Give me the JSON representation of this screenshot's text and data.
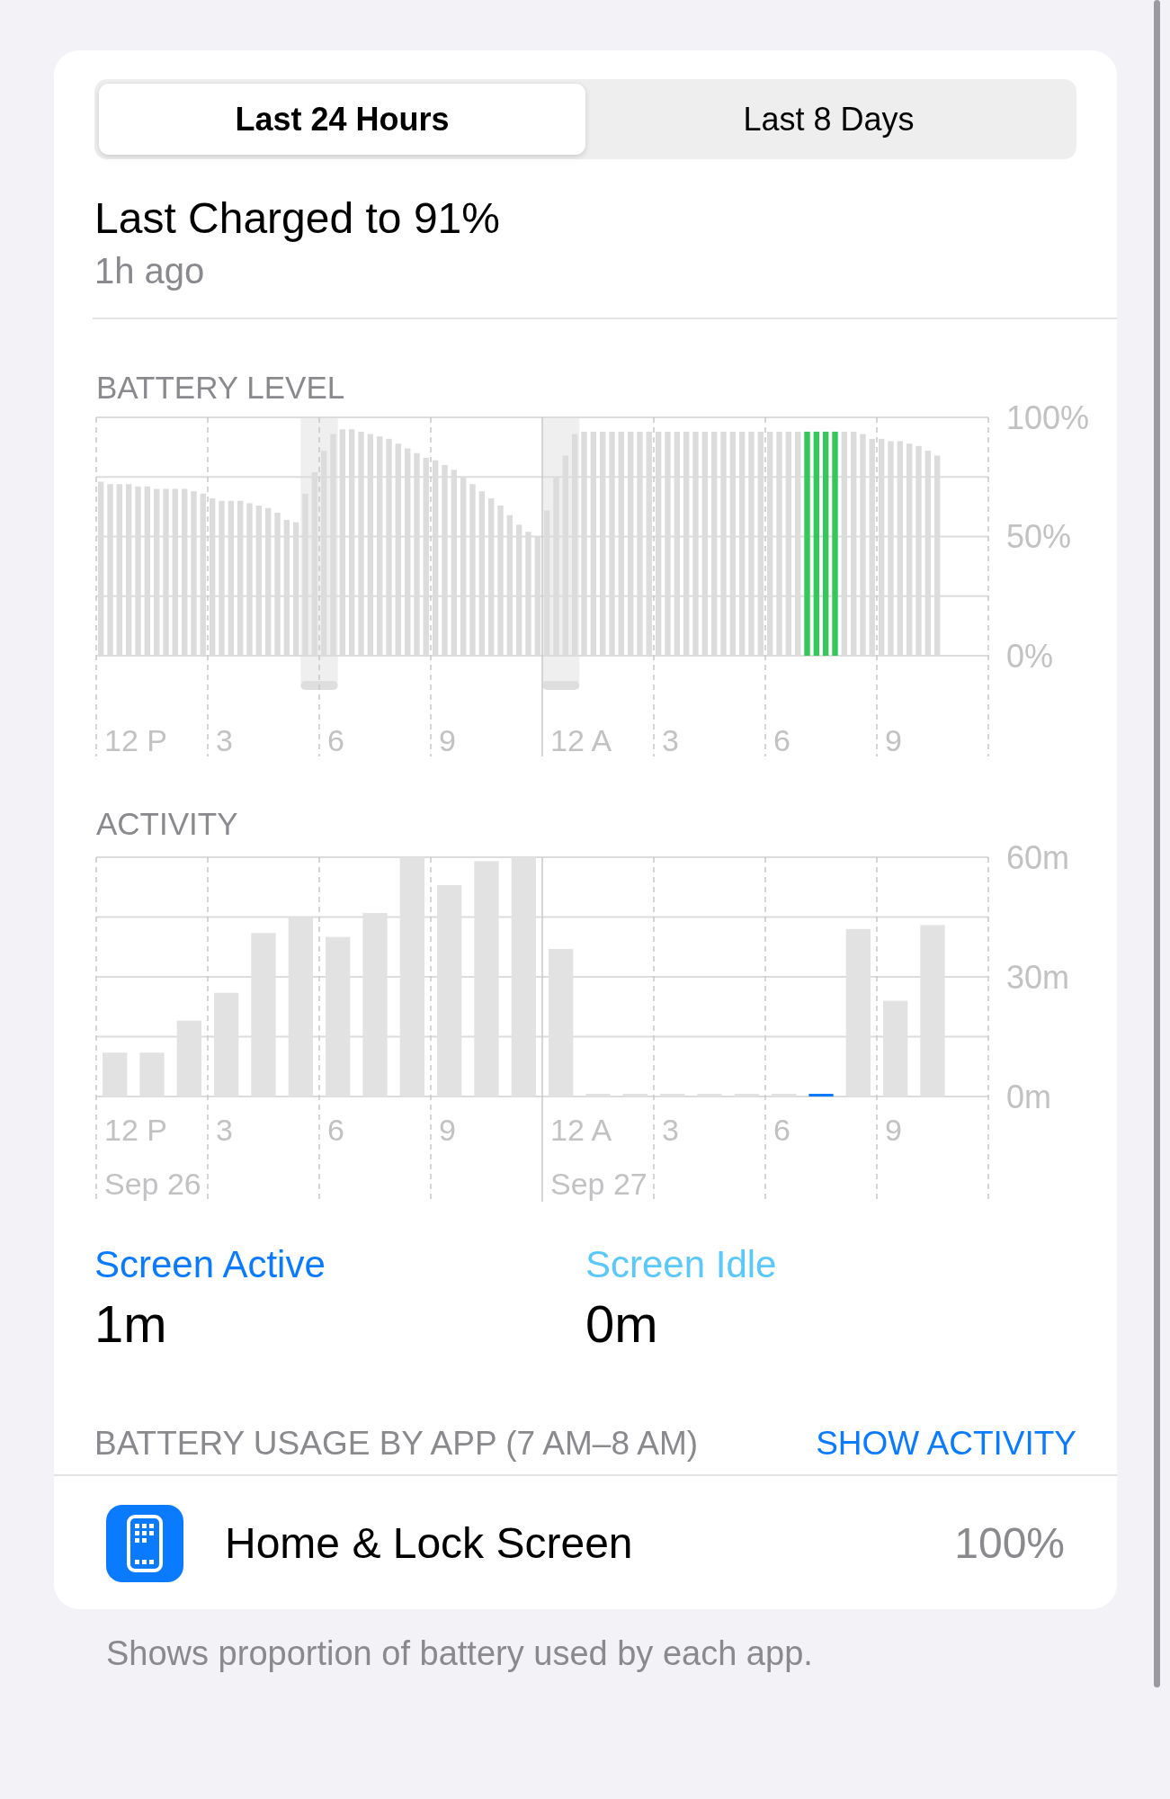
{
  "tabs": [
    {
      "label": "Last 24 Hours",
      "selected": true
    },
    {
      "label": "Last 8 Days",
      "selected": false
    }
  ],
  "last_charged": {
    "title": "Last Charged to 91%",
    "subtitle": "1h ago"
  },
  "battery_level": {
    "heading": "BATTERY LEVEL",
    "hour_labels": [
      "12 P",
      "3",
      "6",
      "9",
      "12 A",
      "3",
      "6",
      "9"
    ],
    "chart_data": {
      "type": "bar",
      "stacked": true,
      "ylim": [
        0,
        100
      ],
      "yticks": [
        {
          "value": 0,
          "label": "0%"
        },
        {
          "value": 50,
          "label": "50%"
        },
        {
          "value": 100,
          "label": "100%"
        }
      ],
      "series": [
        {
          "color": "#dcdcdc",
          "values": [
            73,
            72,
            72,
            72,
            71,
            71,
            70,
            70,
            70,
            70,
            69,
            68,
            66,
            65,
            65,
            65,
            64,
            63,
            62,
            60,
            57,
            56,
            68,
            77,
            86,
            93,
            95,
            95,
            94,
            93,
            92,
            91,
            89,
            87,
            85,
            83,
            82,
            80,
            78,
            75,
            72,
            69,
            66,
            63,
            59,
            55,
            52,
            50,
            61,
            75,
            84,
            93,
            94,
            94,
            94,
            94,
            94,
            94,
            94,
            94,
            94,
            94,
            94,
            94,
            94,
            94,
            94,
            94,
            94,
            94,
            94,
            94,
            94,
            94,
            94,
            94,
            null,
            null,
            null,
            null,
            94,
            94,
            93,
            91,
            91,
            90,
            90,
            89,
            88,
            86,
            84,
            null,
            null,
            null,
            null,
            null
          ]
        },
        {
          "color": "#34c759",
          "values": [
            null,
            null,
            null,
            null,
            null,
            null,
            null,
            null,
            null,
            null,
            null,
            null,
            null,
            null,
            null,
            null,
            null,
            null,
            null,
            null,
            null,
            null,
            null,
            null,
            null,
            null,
            null,
            null,
            null,
            null,
            null,
            null,
            null,
            null,
            null,
            null,
            null,
            null,
            null,
            null,
            null,
            null,
            null,
            null,
            null,
            null,
            null,
            null,
            null,
            null,
            null,
            null,
            null,
            null,
            null,
            null,
            null,
            null,
            null,
            null,
            null,
            null,
            null,
            null,
            null,
            null,
            null,
            null,
            null,
            null,
            null,
            null,
            null,
            null,
            null,
            null,
            94,
            94,
            94,
            94,
            null,
            null,
            null,
            null,
            null,
            null,
            null,
            null,
            null,
            null,
            null,
            null,
            null,
            null,
            null,
            null
          ]
        }
      ]
    }
  },
  "activity": {
    "heading": "ACTIVITY",
    "hour_labels": [
      "12 P",
      "3",
      "6",
      "9",
      "12 A",
      "3",
      "6",
      "9"
    ],
    "dates": [
      "Sep 26",
      "Sep 27"
    ],
    "chart_data": {
      "type": "bar",
      "stacked": true,
      "ylim": [
        0,
        60
      ],
      "yticks": [
        {
          "value": 0,
          "label": "0m"
        },
        {
          "value": 30,
          "label": "30m"
        },
        {
          "value": 60,
          "label": "60m"
        }
      ],
      "series": [
        {
          "color": "#e2e2e2",
          "values": [
            11,
            11,
            19,
            26,
            41,
            45,
            40,
            46,
            60,
            53,
            59,
            60,
            37,
            0,
            0,
            0,
            0,
            0,
            0,
            null,
            42,
            24,
            43,
            null
          ]
        },
        {
          "color": "#0a7aff",
          "values": [
            null,
            null,
            null,
            null,
            null,
            null,
            null,
            null,
            null,
            null,
            null,
            null,
            null,
            null,
            null,
            null,
            null,
            null,
            null,
            0.5,
            null,
            null,
            null,
            null
          ]
        }
      ]
    }
  },
  "screen_stats": [
    {
      "label": "Screen Active",
      "value": "1m",
      "color": "#0a7aff"
    },
    {
      "label": "Screen Idle",
      "value": "0m",
      "color": "#5ac8fa"
    }
  ],
  "usage": {
    "heading": "BATTERY USAGE BY APP (7 AM–8 AM)",
    "action": "SHOW ACTIVITY",
    "apps": [
      {
        "name": "Home & Lock Screen",
        "percent": "100%"
      }
    ]
  },
  "footer": "Shows proportion of battery used by each app."
}
